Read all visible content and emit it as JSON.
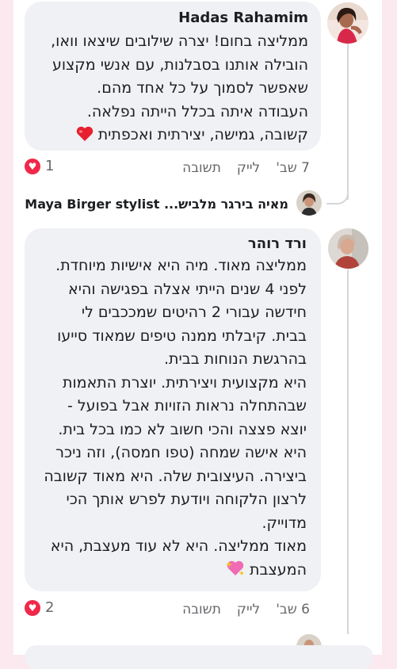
{
  "comment1": {
    "author": "Hadas Rahamim",
    "lines": [
      "ממליצה בחום! יצרה שילובים שיצאו וואו,",
      "הובילה אותנו בסבלנות, עם אנשי מקצוע",
      "שאפשר לסמוך על כל אחד מהם.",
      "העבודה איתה בכלל הייתה נפלאה.",
      "קשובה, גמישה, יצירתית ואכפתית"
    ],
    "time": "7 שב'",
    "like_label": "לייק",
    "reply_label": "תשובה",
    "reaction_count": "1"
  },
  "reply_preview": {
    "text": "מאיה בירגר מלביש... Maya Birger stylist"
  },
  "comment2": {
    "author": "ורד רוהר",
    "lines": [
      "ממליצה מאוד. מיה היא אישיות מיוחדת.",
      "לפני 4 שנים הייתי אצלה בפגישה והיא",
      "חידשה עבורי 2 רהיטים שמככבים לי",
      "בבית. קיבלתי ממנה טיפים שמאוד סייעו",
      "בהרגשת הנוחות בבית.",
      "היא מקצועית ויצירתית. יוצרת התאמות",
      "שבהתחלה נראות הזויות אבל בפועל -",
      "יוצא פצצה והכי חשוב לא כמו בכל בית.",
      "היא אישה שמחה (טפו חמסה), וזה ניכר",
      "ביצירה. העיצובית שלה. היא מאוד קשובה",
      "לרצון הלקוחה ויודעת לפרש אותך הכי",
      "מדוייק.",
      "מאוד ממליצה. היא לא עוד מעצבת, היא",
      "המעצבת"
    ],
    "time": "6 שב'",
    "like_label": "לייק",
    "reply_label": "תשובה",
    "reaction_count": "2"
  },
  "colors": {
    "bubble": "#eff1f4",
    "reaction_heart": "#f0284a",
    "meta_text": "#65676b"
  },
  "icons": {
    "heart_emoji": "red-heart-emoji",
    "sparkling_heart_emoji": "sparkling-heart-emoji",
    "love_reaction": "love-reaction-icon"
  }
}
